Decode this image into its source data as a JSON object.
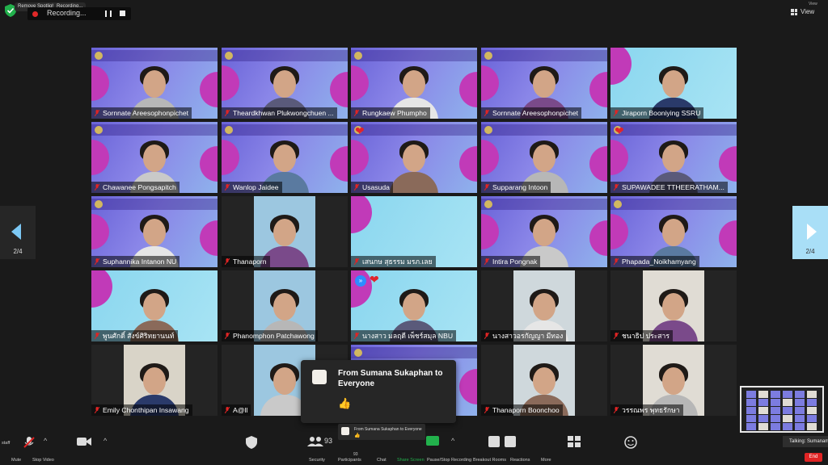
{
  "top": {
    "remove_spotlight": "Remove Spotlight",
    "recording_small": "Recording...",
    "recording": "Recording...",
    "view_label": "View",
    "view_sub": "View"
  },
  "nav": {
    "left_page": "2/4",
    "right_page": "2/4"
  },
  "participants": [
    {
      "name": "Sornnate Areesophonpichet",
      "bg": "slide",
      "heart": false
    },
    {
      "name": "Theardkhwan Plukwongchuen ...",
      "bg": "slide",
      "heart": false
    },
    {
      "name": "Rungkaew Phumpho",
      "bg": "slide",
      "heart": false
    },
    {
      "name": "Sornnate Areesophonpichet",
      "bg": "slide",
      "heart": false
    },
    {
      "name": "Jiraporn Booniying SSRU",
      "bg": "cyan",
      "heart": false
    },
    {
      "name": "Chawanee Pongsapitch",
      "bg": "slide",
      "heart": false
    },
    {
      "name": "Wanlop Jaidee",
      "bg": "slide",
      "heart": false
    },
    {
      "name": "Usasuda",
      "bg": "slide",
      "heart": true
    },
    {
      "name": "Supparang Intoon",
      "bg": "slide",
      "heart": false
    },
    {
      "name": "SUPAWADEE TTHEERATHAM...",
      "bg": "slide",
      "heart": true
    },
    {
      "name": "Suphannika Intanon NU",
      "bg": "slide",
      "heart": false
    },
    {
      "name": "Thanaporn",
      "bg": "dark",
      "heart": false
    },
    {
      "name": "เสนกษ สุธรรม มรภ.เลย",
      "bg": "cyan",
      "heart": false
    },
    {
      "name": "Intira Pongnak",
      "bg": "slide",
      "heart": false
    },
    {
      "name": "Phapada_Noikhamyang",
      "bg": "slide",
      "heart": false
    },
    {
      "name": "พูนศักดิ์ สังข์ศิริทยานนท์",
      "bg": "cyan",
      "heart": false
    },
    {
      "name": "Phanomphon Patchawong",
      "bg": "dark",
      "heart": false
    },
    {
      "name": "นางสาว มลฤดี เพ็ชร์สมุล NBU",
      "bg": "cyan",
      "heart": true
    },
    {
      "name": "นางสาวอรกัญญา มีทอง",
      "bg": "dark",
      "heart": false
    },
    {
      "name": "ชนาธิป ประสาร",
      "bg": "dark",
      "heart": false
    },
    {
      "name": "Emily Chonthipan Insawang",
      "bg": "dark",
      "heart": false
    },
    {
      "name": "A@ll",
      "bg": "dark",
      "heart": false
    },
    {
      "name": "",
      "bg": "slide",
      "heart": false
    },
    {
      "name": "Thanaporn Boonchoo",
      "bg": "dark",
      "heart": false
    },
    {
      "name": "วรรณพร พุทธรักษา",
      "bg": "dark",
      "heart": false
    }
  ],
  "chat_toast": {
    "from": "From Sumana Sukaphan to Everyone",
    "message": "👍"
  },
  "chat_mini": {
    "from": "From Sumana Sukaphan to Everyone",
    "message": "👍"
  },
  "talking": "Talking: Sumanam",
  "toolbar": {
    "mute": "Mute",
    "stop_video": "Stop Video",
    "security": "Security",
    "participants": "Participants",
    "participants_count": "93",
    "participants_count_small": "93",
    "chat": "Chat",
    "share_screen": "Share Screen",
    "pause_stop_recording": "Pause/Stop Recording",
    "breakout_rooms": "Breakout Rooms",
    "reactions": "Reactions",
    "more": "More",
    "end": "End",
    "staff": "staff"
  },
  "colors": {
    "accent": "#2d8cff",
    "end": "#e02424",
    "slide_magenta": "#c13ab8"
  }
}
